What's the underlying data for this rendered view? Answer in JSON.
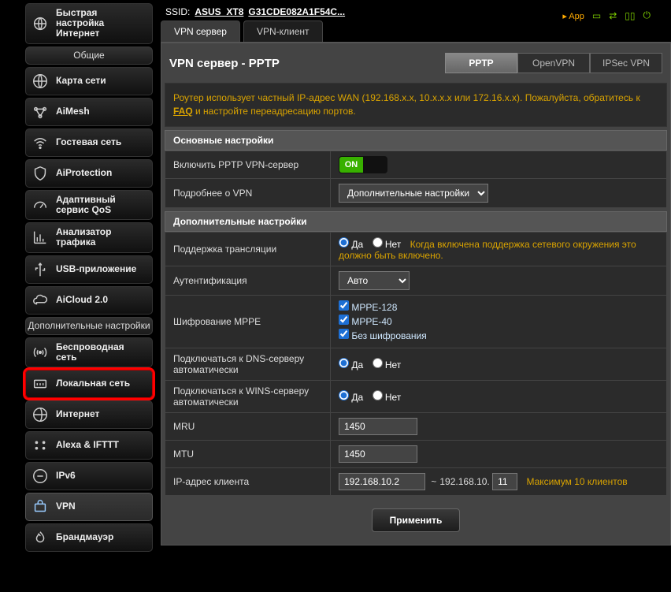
{
  "header": {
    "ssid_label": "SSID:",
    "ssid_value": "ASUS_XT8",
    "mac": "G31CDE082A1F54C...",
    "app_label": "App"
  },
  "sidebar": {
    "quick_setup": "Быстрая настройка Интернет",
    "group_general": "Общие",
    "items_general": [
      "Карта сети",
      "AiMesh",
      "Гостевая сеть",
      "AiProtection",
      "Адаптивный сервис QoS",
      "Анализатор трафика",
      "USB-приложение",
      "AiCloud 2.0"
    ],
    "group_advanced": "Дополнительные настройки",
    "items_advanced": [
      "Беспроводная сеть",
      "Локальная сеть",
      "Интернет",
      "Alexa & IFTTT",
      "IPv6",
      "VPN",
      "Брандмауэр"
    ]
  },
  "tabs": {
    "server": "VPN сервер",
    "client": "VPN-клиент"
  },
  "panel": {
    "title": "VPN сервер - PPTP",
    "subtabs": {
      "pptp": "PPTP",
      "openvpn": "OpenVPN",
      "ipsec": "IPSec VPN"
    }
  },
  "warning": {
    "text": "Роутер использует частный IP-адрес WAN (192.168.x.x, 10.x.x.x или 172.16.x.x). Пожалуйста, обратитесь к ",
    "faq": "FAQ",
    "text2": " и настройте переадресацию портов."
  },
  "sections": {
    "basic": "Основные настройки",
    "advanced": "Дополнительные настройки"
  },
  "rows": {
    "enable_pptp": "Включить PPTP VPN-сервер",
    "on": "ON",
    "more_vpn": "Подробнее о VPN",
    "adv_select": "Дополнительные  настройки",
    "broadcast": "Поддержка трансляции",
    "yes": "Да",
    "no": "Нет",
    "broadcast_note": "Когда включена поддержка сетевого окружения это должно быть включено.",
    "auth": "Аутентификация",
    "auth_val": "Авто",
    "mppe": "Шифрование MPPE",
    "mppe128": "MPPE-128",
    "mppe40": "MPPE-40",
    "no_enc": "Без шифрования",
    "dns_auto": "Подключаться к DNS-серверу автоматически",
    "wins_auto": "Подключаться к WINS-серверу автоматически",
    "mru": "MRU",
    "mru_val": "1450",
    "mtu": "MTU",
    "mtu_val": "1450",
    "client_ip": "IP-адрес клиента",
    "ip_start": "192.168.10.2",
    "ip_end_prefix": "192.168.10.",
    "ip_end_suffix": "11",
    "max_clients": "Максимум 10 клиентов"
  },
  "buttons": {
    "apply": "Применить"
  }
}
